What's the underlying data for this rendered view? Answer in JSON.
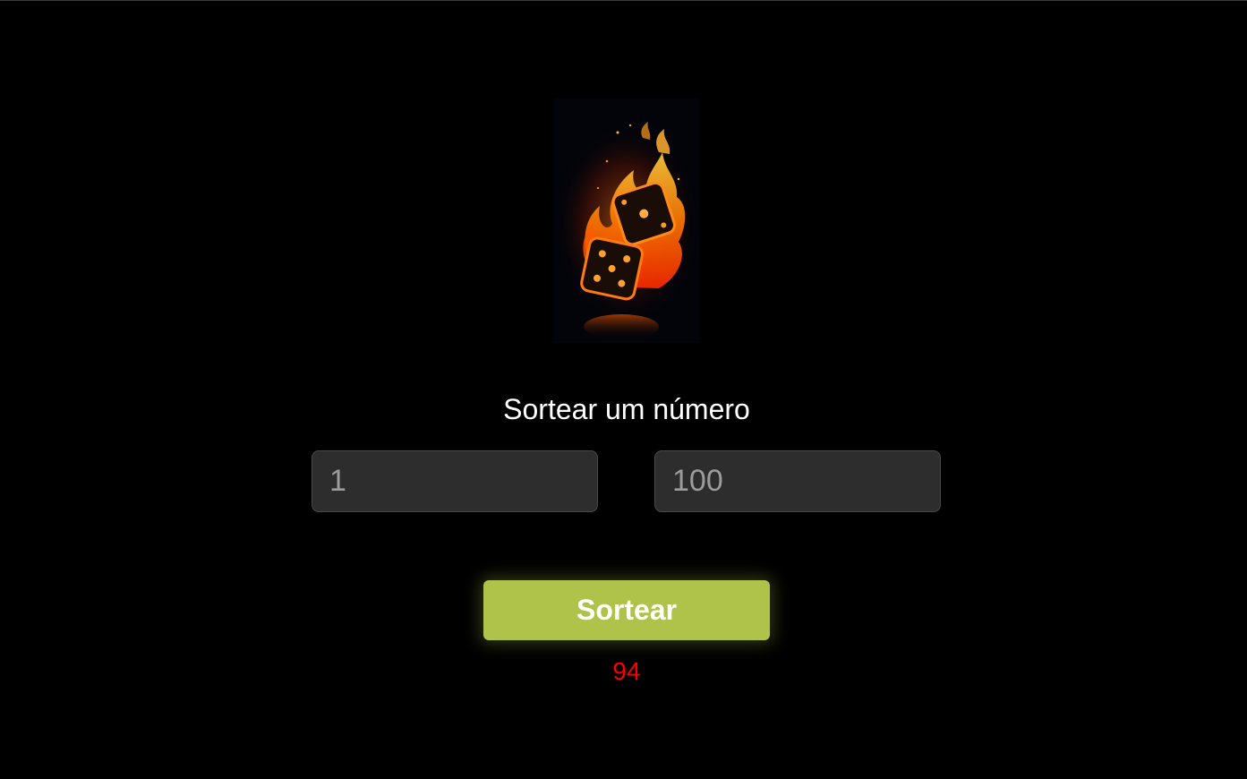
{
  "app": {
    "title": "Sortear um número"
  },
  "hero": {
    "icon": "flaming-dice-icon"
  },
  "form": {
    "min_placeholder": "1",
    "max_placeholder": "100",
    "submit_label": "Sortear"
  },
  "result": {
    "value": "94"
  },
  "colors": {
    "background": "#000000",
    "button": "#afc34a",
    "input_bg": "#2d2d2d",
    "result_text": "#ff0000",
    "flame": "#ff6a00"
  }
}
